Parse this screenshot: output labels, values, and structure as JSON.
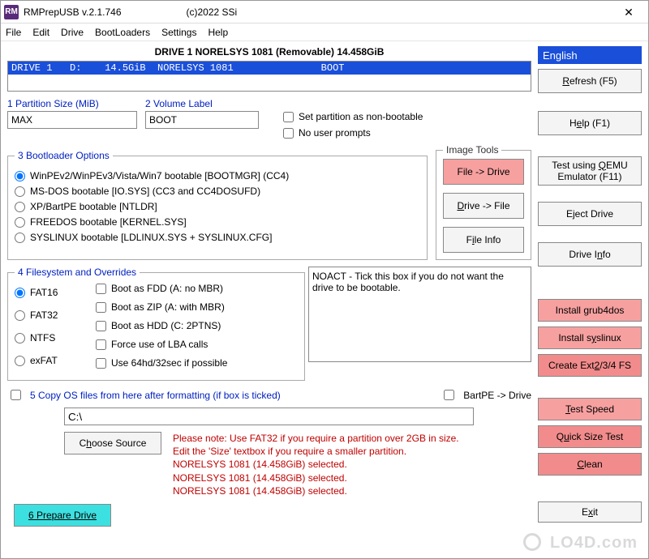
{
  "window": {
    "title": "RMPrepUSB v.2.1.746",
    "subtitle": "(c)2022 SSi",
    "close_glyph": "✕"
  },
  "menu": {
    "file": "File",
    "edit": "Edit",
    "drive": "Drive",
    "bootloaders": "BootLoaders",
    "settings": "Settings",
    "help": "Help"
  },
  "drive": {
    "header": "DRIVE 1 NORELSYS 1081  (Removable) 14.458GiB",
    "row": "DRIVE 1   D:    14.5GiB  NORELSYS 1081               BOOT"
  },
  "section1": {
    "label": "1 Partition Size (MiB)",
    "value": "MAX"
  },
  "section2": {
    "label": "2 Volume Label",
    "value": "BOOT"
  },
  "top_checks": {
    "nonboot": "Set partition as non-bootable",
    "noprompts": "No user prompts"
  },
  "bootloader": {
    "legend": "3 Bootloader Options",
    "opts": [
      "WinPEv2/WinPEv3/Vista/Win7 bootable [BOOTMGR] (CC4)",
      "MS-DOS bootable [IO.SYS]   (CC3 and CC4DOSUFD)",
      "XP/BartPE bootable [NTLDR]",
      "FREEDOS bootable [KERNEL.SYS]",
      "SYSLINUX bootable [LDLINUX.SYS + SYSLINUX.CFG]"
    ]
  },
  "imgtools": {
    "legend": "Image Tools",
    "file_to_drive": "File -> Drive",
    "drive_to_file": "Drive -> File",
    "file_info": "File Info"
  },
  "filesystem": {
    "legend": "4 Filesystem and Overrides",
    "radios": [
      "FAT16",
      "FAT32",
      "NTFS",
      "exFAT"
    ],
    "checks": [
      "Boot as FDD (A: no MBR)",
      "Boot as ZIP (A: with MBR)",
      "Boot as HDD (C: 2PTNS)",
      "Force use of LBA calls",
      "Use 64hd/32sec if possible"
    ],
    "help": "NOACT - Tick this box if you do not want the drive to be bootable."
  },
  "copy": {
    "label": "5 Copy OS files from here after formatting (if box is ticked)",
    "bartpe": "BartPE -> Drive",
    "src": "C:\\",
    "choose": "Choose Source"
  },
  "notes": {
    "l1": "Please note: Use FAT32 if you require a partition over 2GB in size.",
    "l2": "Edit the 'Size' textbox if you require a smaller partition.",
    "l3": "NORELSYS 1081 (14.458GiB) selected.",
    "l4": "NORELSYS 1081 (14.458GiB) selected.",
    "l5": "NORELSYS 1081 (14.458GiB) selected."
  },
  "prepare": {
    "label": "6 Prepare Drive"
  },
  "sidebar": {
    "language": "English",
    "refresh": "Refresh (F5)",
    "help": "Help (F1)",
    "qemu": "Test using QEMU Emulator (F11)",
    "eject": "Eject Drive",
    "driveinfo": "Drive Info",
    "grub4dos": "Install grub4dos",
    "syslinux": "Install syslinux",
    "ext": "Create Ext2/3/4 FS",
    "testspeed": "Test Speed",
    "quicksize": "Quick Size Test",
    "clean": "Clean",
    "exit": "Exit"
  },
  "watermark": "LO4D.com"
}
